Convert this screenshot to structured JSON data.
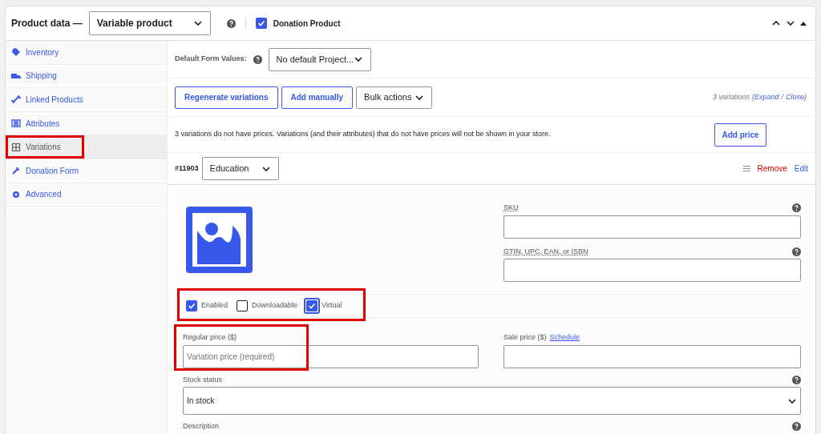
{
  "header": {
    "title": "Product data —",
    "product_type": "Variable product",
    "donation": {
      "label": "Donation Product",
      "checked": true
    }
  },
  "sidebar": {
    "items": [
      {
        "label": "Inventory",
        "selected": false,
        "highlighted": false
      },
      {
        "label": "Shipping",
        "selected": false,
        "highlighted": false
      },
      {
        "label": "Linked Products",
        "selected": false,
        "highlighted": false
      },
      {
        "label": "Attributes",
        "selected": false,
        "highlighted": false
      },
      {
        "label": "Variations",
        "selected": true,
        "highlighted": true
      },
      {
        "label": "Donation Form",
        "selected": false,
        "highlighted": false
      },
      {
        "label": "Advanced",
        "selected": false,
        "highlighted": false
      }
    ]
  },
  "defaults": {
    "label": "Default Form Values:",
    "value": "No default Project..."
  },
  "toolbar": {
    "buttons": [
      "Regenerate variations",
      "Add manually"
    ],
    "bulk": "Bulk actions",
    "count": "3 variations",
    "open_paren": "(",
    "expand": "Expand",
    "separator": "/",
    "close": "Close",
    "close_paren": ")"
  },
  "notice": {
    "text": "3 variations do not have prices. Variations (and their attributes) that do not have prices will not be shown in your store.",
    "button": "Add price"
  },
  "variation": {
    "id": "#11903",
    "attribute": "Education",
    "remove": "Remove",
    "edit": "Edit",
    "sku": {
      "label": "SKU"
    },
    "gtin": {
      "label": "GTIN, UPC, EAN, or ISBN"
    },
    "options": {
      "highlighted": true,
      "items": [
        {
          "label": "Enabled",
          "checked": true,
          "focused": false
        },
        {
          "label": "Downloadable",
          "checked": false,
          "focused": false
        },
        {
          "label": "Virtual",
          "checked": true,
          "focused": true
        }
      ]
    },
    "regular_price": {
      "label": "Regular price ($)",
      "placeholder": "Variation price (required)",
      "highlighted": true
    },
    "sale_price": {
      "label": "Sale price ($)",
      "link": "Schedule"
    },
    "stock": {
      "label": "Stock status",
      "value": "In stock"
    },
    "description": {
      "label": "Description"
    }
  }
}
